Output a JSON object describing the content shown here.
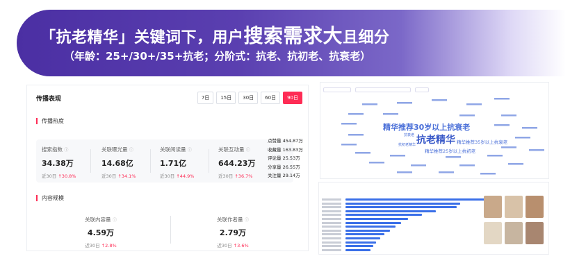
{
  "banner": {
    "headline_part1": "「抗老精华」关键词下，用户",
    "headline_big": "搜索需求大",
    "headline_part2": "且细分",
    "subline": "（年龄：25+/30+/35+抗老；分阶式：抗老、抗初老、抗衰老）"
  },
  "panel": {
    "title": "传播表现",
    "periods": [
      "7日",
      "15日",
      "30日",
      "60日",
      "90日"
    ],
    "active_period": "90日",
    "heat_section": "传播热度",
    "metrics": [
      {
        "label": "搜索指数",
        "value": "34.38万",
        "change_prefix": "近30日",
        "change": "↑30.8%"
      },
      {
        "label": "关联曝光量",
        "value": "14.68亿",
        "change_prefix": "近30日",
        "change": "↑34.1%"
      },
      {
        "label": "关联阅读量",
        "value": "1.71亿",
        "change_prefix": "近30日",
        "change": "↑44.9%"
      },
      {
        "label": "关联互动量",
        "value": "644.23万",
        "change_prefix": "近30日",
        "change": "↑36.7%"
      }
    ],
    "side_stats": [
      {
        "label": "点赞量",
        "value": "454.87万"
      },
      {
        "label": "收藏量",
        "value": "163.83万"
      },
      {
        "label": "评论量",
        "value": "25.53万"
      },
      {
        "label": "分享量",
        "value": "26.55万"
      },
      {
        "label": "关注量",
        "value": "29.14万"
      }
    ],
    "scale_section": "内容规模",
    "scale": [
      {
        "label": "关联内容量",
        "value": "4.59万",
        "change_prefix": "近30日",
        "change": "↑2.8%"
      },
      {
        "label": "关联作者量",
        "value": "2.79万",
        "change_prefix": "近30日",
        "change": "↑3.6%"
      }
    ]
  },
  "wordcloud": {
    "words": [
      {
        "text": "精华推荐30岁以上抗衰老",
        "size": 11
      },
      {
        "text": "抗老精华",
        "size": 14
      },
      {
        "text": "精华推荐35岁以上抗衰老",
        "size": 6.5
      },
      {
        "text": "精华推荐25岁以上抗初老",
        "size": 6.5
      },
      {
        "text": "抗衰老",
        "size": 5
      },
      {
        "text": "抗初老精华",
        "size": 5
      }
    ]
  },
  "colors": {
    "accent": "#fe2c55",
    "banner": "#4b2fa3",
    "bar": "#3a6fe8"
  }
}
